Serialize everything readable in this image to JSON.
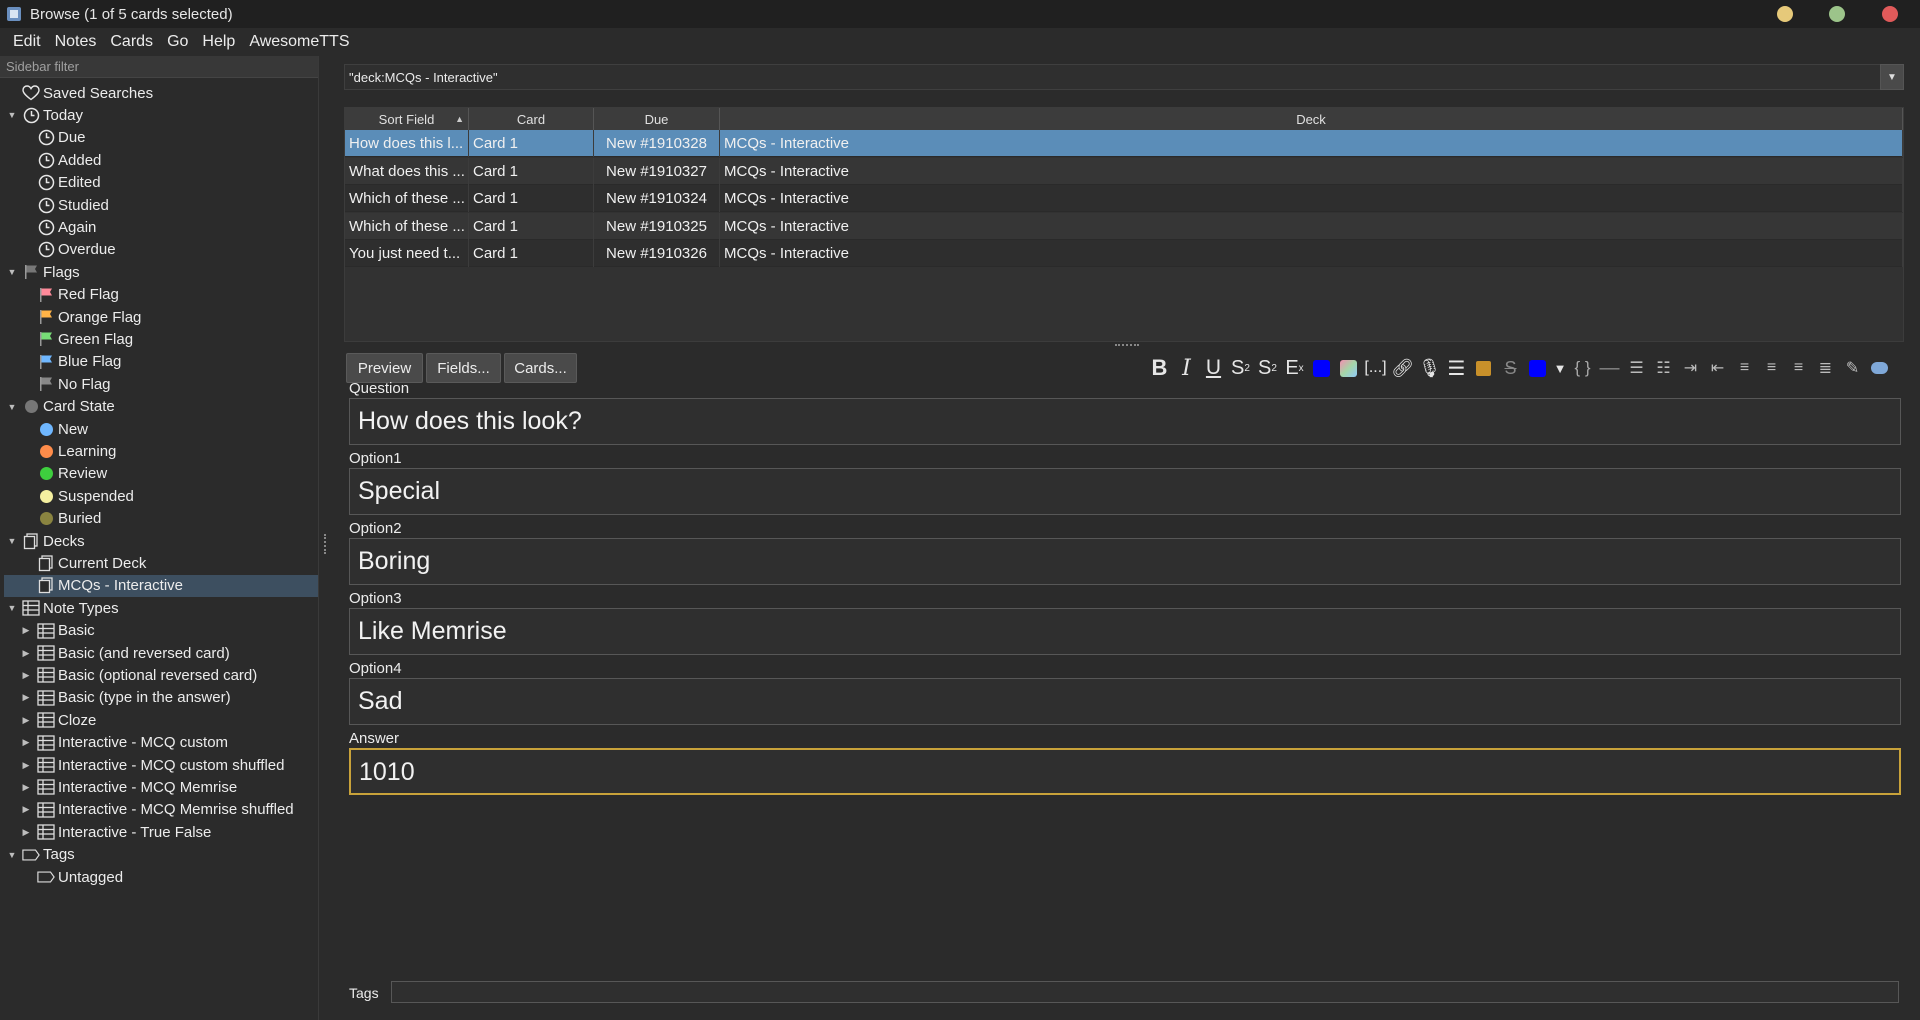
{
  "window": {
    "title": "Browse (1 of 5 cards selected)",
    "controls": {
      "minimize_color": "#e6c97a",
      "maximize_color": "#9cc48a",
      "close_color": "#e05a5a"
    }
  },
  "menu": [
    "Edit",
    "Notes",
    "Cards",
    "Go",
    "Help",
    "AwesomeTTS"
  ],
  "sidebar": {
    "filter_placeholder": "Sidebar filter",
    "saved_searches": "Saved Searches",
    "today": {
      "label": "Today",
      "items": [
        "Due",
        "Added",
        "Edited",
        "Studied",
        "Again",
        "Overdue"
      ]
    },
    "flags": {
      "label": "Flags",
      "items": [
        {
          "label": "Red Flag",
          "color": "#ff8a9a"
        },
        {
          "label": "Orange Flag",
          "color": "#ffb347"
        },
        {
          "label": "Green Flag",
          "color": "#77dd77"
        },
        {
          "label": "Blue Flag",
          "color": "#6fb7ff"
        },
        {
          "label": "No Flag",
          "color": "#888888"
        }
      ]
    },
    "card_state": {
      "label": "Card State",
      "items": [
        {
          "label": "New",
          "color": "#6fb7ff"
        },
        {
          "label": "Learning",
          "color": "#ff8c4a"
        },
        {
          "label": "Review",
          "color": "#3ecf3e"
        },
        {
          "label": "Suspended",
          "color": "#f5f0a0"
        },
        {
          "label": "Buried",
          "color": "#8a8440"
        }
      ]
    },
    "decks": {
      "label": "Decks",
      "items": [
        "Current Deck",
        "MCQs - Interactive"
      ]
    },
    "note_types": {
      "label": "Note Types",
      "items": [
        "Basic",
        "Basic (and reversed card)",
        "Basic (optional reversed card)",
        "Basic (type in the answer)",
        "Cloze",
        "Interactive - MCQ custom",
        "Interactive - MCQ custom shuffled",
        "Interactive - MCQ Memrise",
        "Interactive - MCQ Memrise shuffled",
        "Interactive - True False"
      ]
    },
    "tags": {
      "label": "Tags",
      "items": [
        "Untagged"
      ]
    }
  },
  "search": {
    "value": "\"deck:MCQs - Interactive\""
  },
  "table": {
    "columns": [
      "Sort Field",
      "Card",
      "Due",
      "Deck"
    ],
    "rows": [
      [
        "How does this l...",
        "Card 1",
        "New #1910328",
        "MCQs - Interactive"
      ],
      [
        "What does this ...",
        "Card 1",
        "New #1910327",
        "MCQs - Interactive"
      ],
      [
        "Which of these ...",
        "Card 1",
        "New #1910324",
        "MCQs - Interactive"
      ],
      [
        "Which of these ...",
        "Card 1",
        "New #1910325",
        "MCQs - Interactive"
      ],
      [
        "You just need t...",
        "Card 1",
        "New #1910326",
        "MCQs - Interactive"
      ]
    ]
  },
  "editor": {
    "buttons": {
      "preview": "Preview",
      "fields": "Fields...",
      "cards": "Cards..."
    },
    "fields": [
      {
        "label": "Question",
        "value": "How does this look?"
      },
      {
        "label": "Option1",
        "value": "Special"
      },
      {
        "label": "Option2",
        "value": "Boring"
      },
      {
        "label": "Option3",
        "value": "Like Memrise"
      },
      {
        "label": "Option4",
        "value": "Sad"
      },
      {
        "label": "Answer",
        "value": "1010"
      }
    ],
    "tags_label": "Tags"
  }
}
